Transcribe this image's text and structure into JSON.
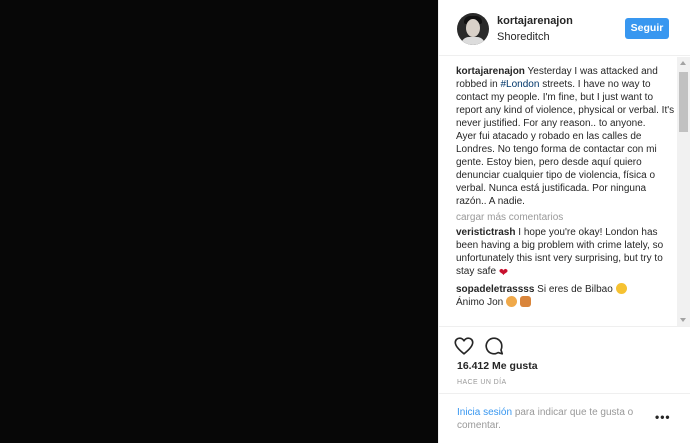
{
  "post": {
    "username": "kortajarenajon",
    "location": "Shoreditch",
    "follow_label": "Seguir"
  },
  "caption": {
    "username": "kortajarenajon",
    "text_before_tag": "Yesterday I was attacked and robbed in",
    "hashtag": "#London",
    "text_after_tag": "streets. I have no way to contact my people. I'm fine, but I just want to report any kind of violence, physical or verbal. It's never justified. For any reason.. to anyone.",
    "text_spanish": "Ayer fui atacado y robado en las calles de Londres. No tengo forma de contactar con mi gente. Estoy bien, pero desde aquí quiero denunciar cualquier tipo de violencia, física o verbal. Nunca está justificada. Por ninguna razón.. A nadie."
  },
  "load_more_label": "cargar más comentarios",
  "comments": [
    {
      "username": "veristictrash",
      "text": "I hope you're okay! London has been having a big problem with crime lately, so unfortunately this isnt very surprising, but try to stay safe"
    },
    {
      "username": "sopadeletrassss",
      "text": "Si eres de Bilbao",
      "text2": "Ánimo Jon"
    }
  ],
  "likes_label": "16.412 Me gusta",
  "timestamp": "Hace un día",
  "login": {
    "link": "Inicia sesión",
    "rest": "para indicar que te gusta o comentar."
  },
  "more_options_label": "•••",
  "icons": {
    "like": "heart-outline-icon",
    "comment": "comment-bubble-icon"
  },
  "colors": {
    "accent": "#3897f0",
    "hashtag": "#003569",
    "muted": "#999999"
  }
}
